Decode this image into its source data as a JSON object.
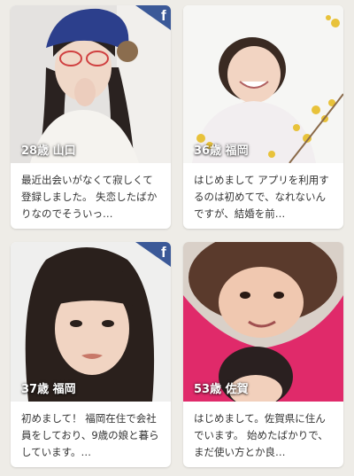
{
  "colors": {
    "background": "#eeece7",
    "card": "#ffffff",
    "facebook": "#3b5998",
    "text": "#333333"
  },
  "profiles": [
    {
      "age_location": "28歳 山口",
      "description": "最近出会いがなくて寂しくて登録しました。 失恋したばかりなのでそういっ…",
      "facebook_linked": true,
      "facebook_icon": "facebook-icon"
    },
    {
      "age_location": "36歳 福岡",
      "description": "はじめまして アプリを利用するのは初めてで、なれないんですが、結婚を前…",
      "facebook_linked": false
    },
    {
      "age_location": "37歳 福岡",
      "description": "初めまして！ 福岡在住で会社員をしており、9歳の娘と暮らしています。…",
      "facebook_linked": true,
      "facebook_icon": "facebook-icon"
    },
    {
      "age_location": "53歳 佐賀",
      "description": "はじめまして。佐賀県に住んでいます。 始めたばかりで、まだ使い方とか良…",
      "facebook_linked": false
    }
  ]
}
